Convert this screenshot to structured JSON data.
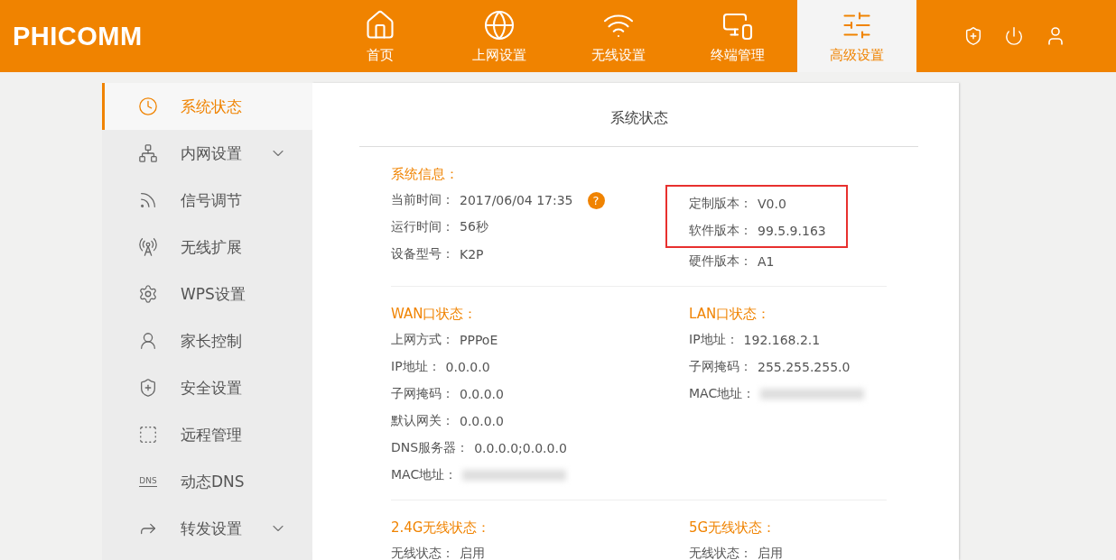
{
  "header": {
    "logo": "PHICOMM",
    "nav": [
      {
        "label": "首页",
        "selected": false
      },
      {
        "label": "上网设置",
        "selected": false
      },
      {
        "label": "无线设置",
        "selected": false
      },
      {
        "label": "终端管理",
        "selected": false
      },
      {
        "label": "高级设置",
        "selected": true
      }
    ]
  },
  "sidebar": {
    "items": [
      {
        "label": "系统状态",
        "selected": true
      },
      {
        "label": "内网设置",
        "selected": false,
        "expanded": false
      },
      {
        "label": "信号调节",
        "selected": false
      },
      {
        "label": "无线扩展",
        "selected": false
      },
      {
        "label": "WPS设置",
        "selected": false
      },
      {
        "label": "家长控制",
        "selected": false
      },
      {
        "label": "安全设置",
        "selected": false
      },
      {
        "label": "远程管理",
        "selected": false
      },
      {
        "label": "动态DNS",
        "selected": false,
        "icon_text": "DNS"
      },
      {
        "label": "转发设置",
        "selected": false,
        "expanded": false
      }
    ]
  },
  "panel": {
    "title": "系统状态",
    "sections": [
      {
        "columns": [
          {
            "heading": "系统信息：",
            "rows": [
              {
                "label": "当前时间：",
                "value": "2017/06/04 17:35",
                "help": "?"
              },
              {
                "label": "运行时间：",
                "value": "56秒"
              },
              {
                "label": "设备型号：",
                "value": "K2P"
              }
            ]
          },
          {
            "rows": [
              {
                "label": "定制版本：",
                "value": "V0.0",
                "highlighted": true
              },
              {
                "label": "软件版本：",
                "value": "99.5.9.163",
                "highlighted": true
              },
              {
                "label": "硬件版本：",
                "value": "A1"
              }
            ]
          }
        ]
      },
      {
        "columns": [
          {
            "heading": "WAN口状态：",
            "rows": [
              {
                "label": "上网方式：",
                "value": "PPPoE"
              },
              {
                "label": "IP地址：",
                "value": "0.0.0.0"
              },
              {
                "label": "子网掩码：",
                "value": "0.0.0.0"
              },
              {
                "label": "默认网关：",
                "value": "0.0.0.0"
              },
              {
                "label": "DNS服务器：",
                "value": "0.0.0.0;0.0.0.0"
              },
              {
                "label": "MAC地址：",
                "blurred": true
              }
            ]
          },
          {
            "heading": "LAN口状态：",
            "rows": [
              {
                "label": "IP地址：",
                "value": "192.168.2.1"
              },
              {
                "label": "子网掩码：",
                "value": "255.255.255.0"
              },
              {
                "label": "MAC地址：",
                "blurred": true
              }
            ]
          }
        ]
      },
      {
        "columns": [
          {
            "heading": "2.4G无线状态：",
            "rows": [
              {
                "label": "无线状态：",
                "value": "启用"
              }
            ]
          },
          {
            "heading": "5G无线状态：",
            "rows": [
              {
                "label": "无线状态：",
                "value": "启用"
              }
            ]
          }
        ]
      }
    ]
  }
}
